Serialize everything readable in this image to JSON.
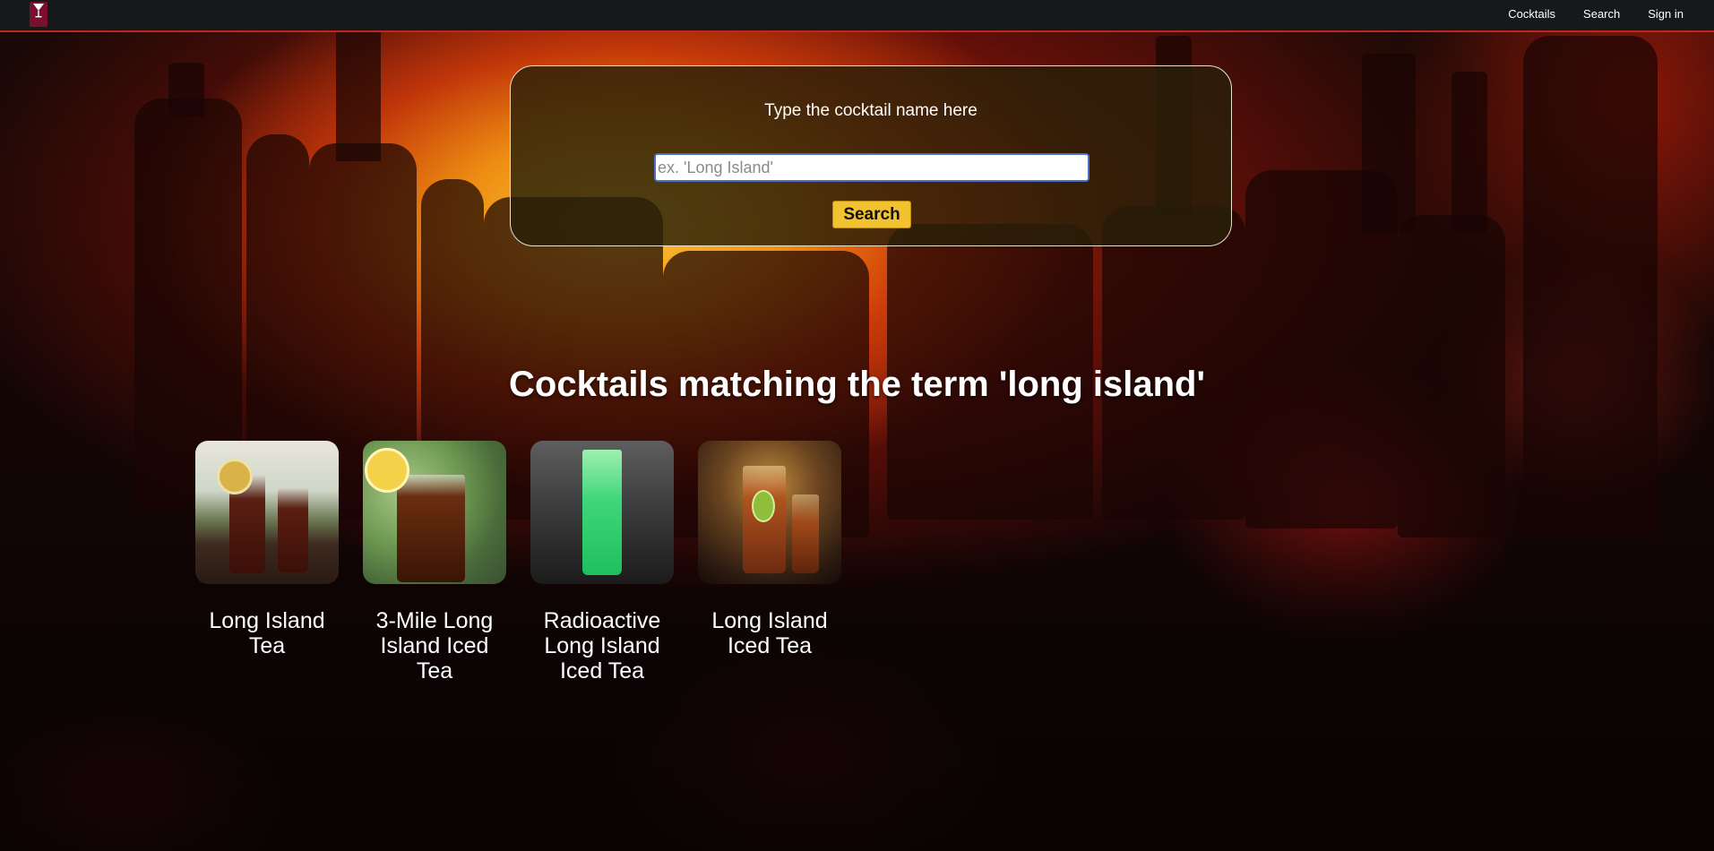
{
  "nav": {
    "logo_alt": "cocktail logo",
    "links": [
      "Cocktails",
      "Search",
      "Sign in"
    ]
  },
  "search": {
    "prompt": "Type the cocktail name here",
    "placeholder": "ex. 'Long Island'",
    "value": "",
    "button_label": "Search"
  },
  "results": {
    "heading": "Cocktails matching the term 'long island'",
    "items": [
      {
        "name": "Long Island Tea",
        "image": "photo of two iced tea glasses by a window"
      },
      {
        "name": "3-Mile Long Island Iced Tea",
        "image": "photo of iced tea with a lemon slice"
      },
      {
        "name": "Radioactive Long Island Iced Tea",
        "image": "photo of a bright green drink"
      },
      {
        "name": "Long Island Iced Tea",
        "image": "photo of iced tea with a lime wedge at a bar"
      }
    ]
  },
  "colors": {
    "nav_bg": "#15191b",
    "nav_border": "#c0261a",
    "button": "#f2c230",
    "panel_border": "#e9e2d0"
  }
}
